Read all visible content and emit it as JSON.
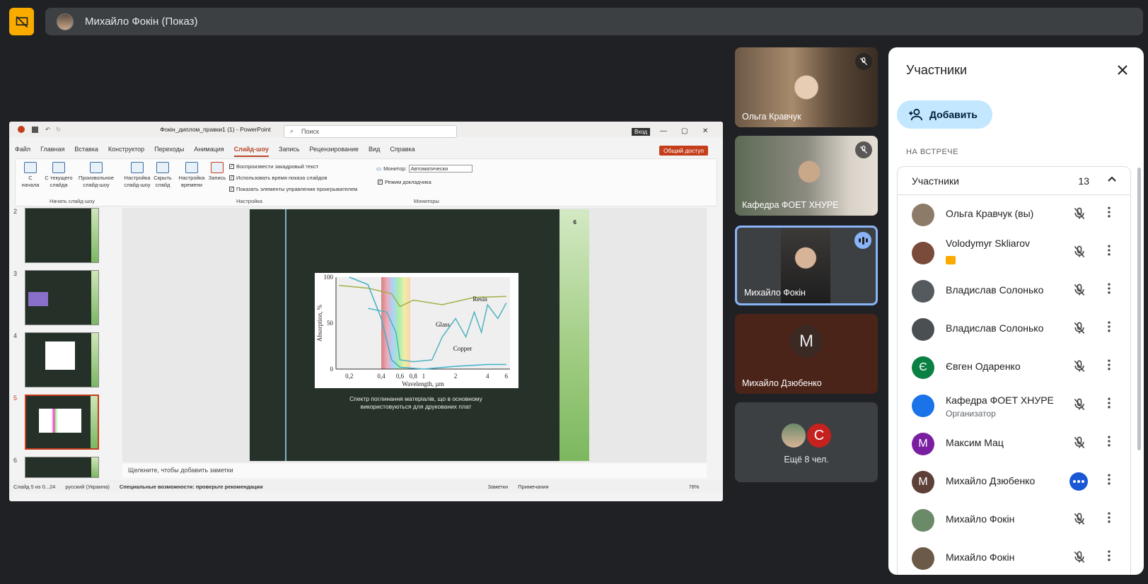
{
  "meet": {
    "presenter_title": "Михайло Фокін (Показ)",
    "colors": {
      "accent_stop": "#f9ab00",
      "speaking": "#8ab4f8",
      "bg": "#202124"
    }
  },
  "powerpoint": {
    "doc_title": "Фокін_диплом_правки1 (1) - PowerPoint",
    "search_placeholder": "Поиск",
    "signin": "Вход",
    "share": "Общий доступ",
    "menu": [
      "Файл",
      "Главная",
      "Вставка",
      "Конструктор",
      "Переходы",
      "Анимация",
      "Слайд-шоу",
      "Запись",
      "Рецензирование",
      "Вид",
      "Справка"
    ],
    "active_menu": "Слайд-шоу",
    "ribbon": {
      "btn_from_start": "С начала",
      "btn_from_current": "С текущего слайда",
      "btn_custom": "Произвольное слайд-шоу",
      "group_start": "Начать слайд-шоу",
      "btn_setup": "Настройка слайд-шоу",
      "btn_hide": "Скрыть слайд",
      "btn_timing": "Настройка времени",
      "btn_record": "Запись",
      "chk_narration": "Воспроизвести закадровый текст",
      "chk_timings": "Использовать время показа слайдов",
      "chk_controls": "Показать элементы управления проигрывателем",
      "group_setup": "Настройка",
      "monitor_label": "Монитор:",
      "monitor_value": "Автоматически",
      "chk_presenter": "Режим докладчика",
      "group_monitors": "Мониторы"
    },
    "thumb_numbers": [
      "2",
      "3",
      "4",
      "5",
      "6"
    ],
    "selected_slide": "5",
    "slide": {
      "page_number": "6",
      "caption_line1": "Спектр поглинання матеріалів, що в основному",
      "caption_line2": "використовуються для друкованих плат"
    },
    "notes_placeholder": "Щелкните, чтобы добавить заметки",
    "status": {
      "slide_info": "Слайд 5 из 0...24",
      "language": "русский (Украина)",
      "accessibility": "Специальные возможности: проверьте рекомендации",
      "notes": "Заметки",
      "comments": "Примечания",
      "zoom": "78%"
    }
  },
  "chart_data": {
    "type": "line",
    "title": "",
    "xlabel": "Wavelength, µm",
    "ylabel": "Absorption, %",
    "x_scale": "log",
    "x_ticks": [
      "0,2",
      "0,4",
      "0,6",
      "0,8",
      "1",
      "2",
      "4",
      "6"
    ],
    "y_ticks": [
      "0",
      "50",
      "100"
    ],
    "ylim": [
      0,
      100
    ],
    "xlim": [
      0.15,
      6.5
    ],
    "series": [
      {
        "name": "Resin",
        "points": [
          [
            0.16,
            91
          ],
          [
            0.3,
            88
          ],
          [
            0.5,
            82
          ],
          [
            0.6,
            68
          ],
          [
            0.8,
            75
          ],
          [
            1.5,
            70
          ],
          [
            3,
            78
          ],
          [
            6,
            79
          ]
        ]
      },
      {
        "name": "Glass",
        "points": [
          [
            0.3,
            66
          ],
          [
            0.45,
            62
          ],
          [
            0.55,
            40
          ],
          [
            0.6,
            10
          ],
          [
            0.8,
            8
          ],
          [
            1.2,
            10
          ],
          [
            1.5,
            35
          ],
          [
            2,
            55
          ],
          [
            2.5,
            35
          ],
          [
            3,
            62
          ],
          [
            3.5,
            40
          ],
          [
            4,
            70
          ],
          [
            5,
            55
          ],
          [
            6,
            72
          ]
        ]
      },
      {
        "name": "Copper",
        "points": [
          [
            0.2,
            100
          ],
          [
            0.3,
            92
          ],
          [
            0.4,
            55
          ],
          [
            0.5,
            10
          ],
          [
            0.6,
            2
          ],
          [
            1,
            0
          ],
          [
            2,
            3
          ],
          [
            4,
            5
          ],
          [
            6,
            5
          ]
        ]
      }
    ],
    "grid": false
  },
  "tiles": [
    {
      "name": "Ольга Кравчук",
      "muted": true
    },
    {
      "name": "Кафедра ФОЕТ ХНУРЕ",
      "muted": true
    },
    {
      "name": "Михайло Фокін",
      "speaking": true
    },
    {
      "name": "Михайло Дзюбенко",
      "initial": "M"
    },
    {
      "more": "Ещё 8 чел.",
      "initial": "C"
    }
  ],
  "panel": {
    "title": "Участники",
    "add_label": "Добавить",
    "section": "НА ВСТРЕЧЕ",
    "group_label": "Участники",
    "count": "13",
    "people": [
      {
        "name": "Ольга Кравчук (вы)",
        "color": "#8d7b6a"
      },
      {
        "name": "Volodymyr Skliarov",
        "color": "#7a4a3a"
      },
      {
        "name": "Владислав Солонько",
        "color": "#555a5e"
      },
      {
        "name": "Владислав Солонько",
        "color": "#4a4f52"
      },
      {
        "name": "Євген Одаренко",
        "initial": "Є",
        "color": "#0b8043"
      },
      {
        "name": "Кафедра ФОЕТ ХНУРЕ",
        "sub": "Организатор",
        "color": "#1a73e8"
      },
      {
        "name": "Максим Мац",
        "initial": "M",
        "color": "#7b1fa2"
      },
      {
        "name": "Михайло Дзюбенко",
        "initial": "M",
        "color": "#5d4037"
      },
      {
        "name": "Михайло Фокін",
        "color": "#6b8a68"
      },
      {
        "name": "Михайло Фокін",
        "color": "#6b5a48"
      }
    ]
  }
}
